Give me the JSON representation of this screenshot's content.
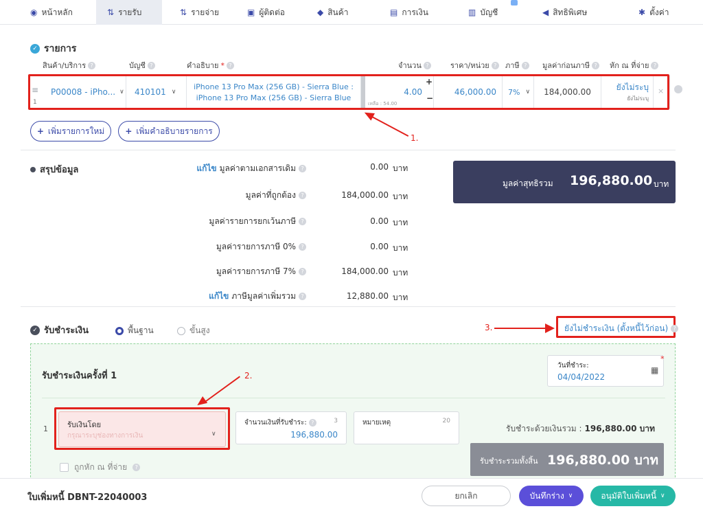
{
  "nav": [
    {
      "label": "หน้าหลัก",
      "icon": "home-icon"
    },
    {
      "label": "รายรับ",
      "icon": "income-icon"
    },
    {
      "label": "รายจ่าย",
      "icon": "expense-icon"
    },
    {
      "label": "ผู้ติดต่อ",
      "icon": "contact-icon"
    },
    {
      "label": "สินค้า",
      "icon": "product-icon"
    },
    {
      "label": "การเงิน",
      "icon": "money-icon"
    },
    {
      "label": "บัญชี",
      "icon": "accounting-icon"
    },
    {
      "label": "สิทธิพิเศษ",
      "icon": "megaphone-icon"
    },
    {
      "label": "ตั้งค่า",
      "icon": "gear-icon"
    }
  ],
  "items": {
    "title": "รายการ",
    "headers": {
      "product": "สินค้า/บริการ",
      "account": "บัญชี",
      "description": "คำอธิบาย",
      "required": "*",
      "quantity": "จำนวน",
      "unit_price": "ราคา/หน่วย",
      "tax": "ภาษี",
      "pre_tax": "มูลค่าก่อนภาษี",
      "withholding": "หัก ณ ที่จ่าย"
    },
    "row": {
      "index": "1",
      "product": "P00008 - iPho...",
      "account": "410101",
      "description_line1": "iPhone 13 Pro Max (256 GB) - Sierra Blue :",
      "description_line2": "iPhone 13 Pro Max (256 GB) - Sierra Blue",
      "quantity": "4.00",
      "remaining": "เหลือ : 54.00",
      "unit_price": "46,000.00",
      "tax": "7%",
      "pre_tax": "184,000.00",
      "withholding": "ยังไม่ระบุ",
      "withholding_sub": "ยังไม่ระบุ"
    },
    "add_item": "เพิ่มรายการใหม่",
    "add_description": "เพิ่มคำอธิบายรายการ"
  },
  "summary": {
    "title": "สรุปข้อมูล",
    "edit": "แก้ไข",
    "rows": [
      {
        "label": "มูลค่าตามเอกสารเดิม",
        "value": "0.00",
        "unit": "บาท",
        "editable": true
      },
      {
        "label": "มูลค่าที่ถูกต้อง",
        "value": "184,000.00",
        "unit": "บาท",
        "editable": false
      },
      {
        "label": "มูลค่ารายการยกเว้นภาษี",
        "value": "0.00",
        "unit": "บาท",
        "editable": false
      },
      {
        "label": "มูลค่ารายการภาษี 0%",
        "value": "0.00",
        "unit": "บาท",
        "editable": false
      },
      {
        "label": "มูลค่ารายการภาษี 7%",
        "value": "184,000.00",
        "unit": "บาท",
        "editable": false
      },
      {
        "label": "ภาษีมูลค่าเพิ่มรวม",
        "value": "12,880.00",
        "unit": "บาท",
        "editable": true
      }
    ],
    "net_label": "มูลค่าสุทธิรวม",
    "net_value": "196,880.00",
    "net_unit": "บาท"
  },
  "payment": {
    "title": "รับชำระเงิน",
    "mode_basic": "พื้นฐาน",
    "mode_advanced": "ขั้นสูง",
    "unpaid_link": "ยังไม่ชำระเงิน (ตั้งหนี้ไว้ก่อน)",
    "round_title": "รับชำระเงินครั้งที่ 1",
    "date_label": "วันที่ชำระ:",
    "date_value": "04/04/2022",
    "row_index": "1",
    "method_label": "รับเงินโดย",
    "method_placeholder": "กรุณาระบุช่องทางการเงิน",
    "amount_label": "จำนวนเงินที่รับชำระ:",
    "amount_count": "3",
    "amount_value": "196,880.00",
    "note_label": "หมายเหตุ",
    "note_count": "20",
    "total_label": "รับชำระด้วยเงินรวม :",
    "total_value": "196,880.00 บาท",
    "withheld_label": "ถูกหัก ณ ที่จ่าย",
    "grand_label": "รับชำระรวมทั้งสิ้น",
    "grand_value": "196,880.00 บาท"
  },
  "annotations": {
    "one": "1.",
    "two": "2.",
    "three": "3."
  },
  "footer": {
    "doc_title": "ใบเพิ่มหนี้ DBNT-22040003",
    "cancel": "ยกเลิก",
    "save_draft": "บันทึกร่าง",
    "approve": "อนุมัติใบเพิ่มหนี้"
  },
  "colors": {
    "accent": "#3a86c8",
    "navy": "#3a3e5f",
    "annotation_red": "#e2211c",
    "purple": "#5b4fd9",
    "teal": "#26b8a6"
  }
}
